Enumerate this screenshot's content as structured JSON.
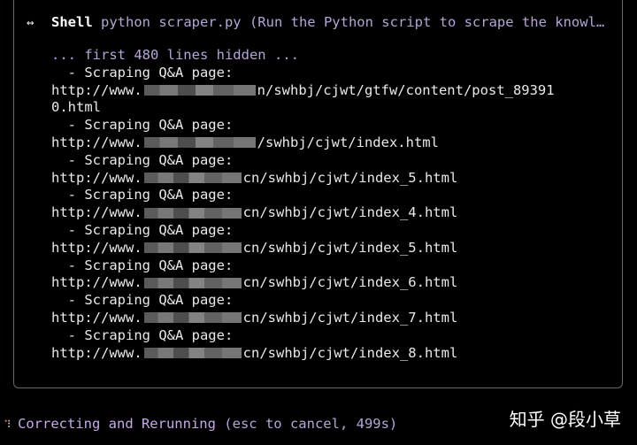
{
  "header": {
    "arrow": "↔",
    "tool": "Shell",
    "command": " python scraper.py (Run the Python script to scrape the knowl…"
  },
  "output": {
    "hidden_note": "... first 480 lines hidden ...",
    "label": "  - Scraping Q&A page:",
    "prefix": "http://www.",
    "lines": [
      {
        "suffix": "n/swhbj/cjwt/gtfw/content/post_89391"
      },
      {
        "suffix": "/swhbj/cjwt/index.html"
      },
      {
        "suffix": "cn/swhbj/cjwt/index_5.html"
      },
      {
        "suffix": "cn/swhbj/cjwt/index_4.html"
      },
      {
        "suffix": "cn/swhbj/cjwt/index_5.html"
      },
      {
        "suffix": "cn/swhbj/cjwt/index_6.html"
      },
      {
        "suffix": "cn/swhbj/cjwt/index_7.html"
      },
      {
        "suffix": "cn/swhbj/cjwt/index_8.html"
      }
    ],
    "wrap": "0.html"
  },
  "status": {
    "spinner": "⠹",
    "main": "Correcting and Rerunning",
    "hint": " (esc to cancel, 499s)"
  },
  "watermark": "知乎 @段小草",
  "colors": {
    "accent": "#b7a4d8",
    "border": "#6b6a52",
    "background": "#000000"
  }
}
